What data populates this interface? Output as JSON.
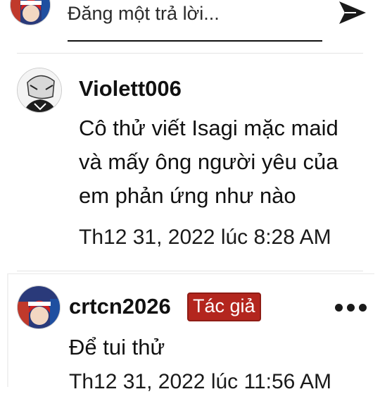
{
  "composer": {
    "placeholder": "Đăng một trả lời...",
    "avatar_icon": "user-avatar-icon",
    "send_icon": "send-icon"
  },
  "comments": [
    {
      "author": "Violett006",
      "avatar_icon": "user-avatar-icon",
      "body_lines": [
        "Cô thử viết Isagi mặc maid",
        "và mấy ông người yêu của",
        "em phản ứng như nào"
      ],
      "timestamp": "Th12 31, 2022 lúc 8:28 AM"
    },
    {
      "author": "crtcn2026",
      "avatar_icon": "user-avatar-icon",
      "badge": "Tác giả",
      "body": "Để tui thử",
      "timestamp": "Th12 31, 2022 lúc 11:56 AM",
      "more_icon": "more-options-icon"
    }
  ],
  "colors": {
    "badge_bg": "#b3261e",
    "text": "#111111",
    "divider": "#e4e4e4"
  }
}
